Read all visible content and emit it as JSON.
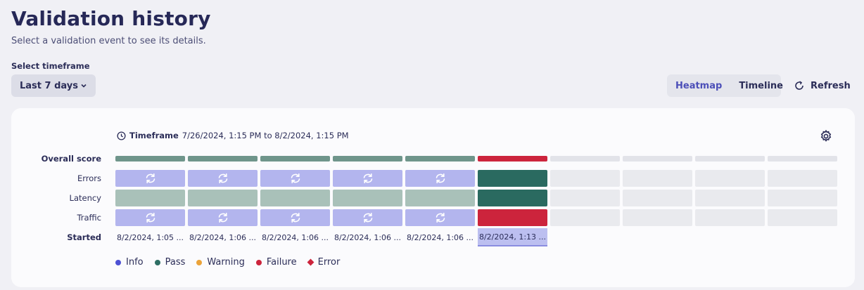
{
  "header": {
    "title": "Validation history",
    "subtitle": "Select a validation event to see its details."
  },
  "timeframe_select": {
    "label": "Select timeframe",
    "value": "Last 7 days"
  },
  "view_toggle": {
    "options": [
      "Heatmap",
      "Timeline"
    ],
    "active": "Heatmap"
  },
  "refresh": {
    "label": "Refresh"
  },
  "heatmap": {
    "timeframe_prefix": "Timeframe",
    "timeframe_range": "7/26/2024, 1:15 PM to 8/2/2024, 1:15 PM",
    "row_labels": {
      "overall": "Overall score",
      "errors": "Errors",
      "latency": "Latency",
      "traffic": "Traffic",
      "started": "Started"
    },
    "columns": [
      {
        "overall": "pass-muted",
        "errors": "info-running",
        "latency": "pass-muted",
        "traffic": "info-running",
        "started": "8/2/2024, 1:05 ..."
      },
      {
        "overall": "pass-muted",
        "errors": "info-running",
        "latency": "pass-muted",
        "traffic": "info-running",
        "started": "8/2/2024, 1:06 ..."
      },
      {
        "overall": "pass-muted",
        "errors": "info-running",
        "latency": "pass-muted",
        "traffic": "info-running",
        "started": "8/2/2024, 1:06 ..."
      },
      {
        "overall": "pass-muted",
        "errors": "info-running",
        "latency": "pass-muted",
        "traffic": "info-running",
        "started": "8/2/2024, 1:06 ..."
      },
      {
        "overall": "pass-muted",
        "errors": "info-running",
        "latency": "pass-muted",
        "traffic": "info-running",
        "started": "8/2/2024, 1:06 ..."
      },
      {
        "overall": "failure",
        "errors": "pass",
        "latency": "pass",
        "traffic": "failure",
        "started": "8/2/2024, 1:13 ...",
        "selected": true
      },
      {
        "overall": "empty",
        "errors": "empty",
        "latency": "empty",
        "traffic": "empty",
        "started": ""
      },
      {
        "overall": "empty",
        "errors": "empty",
        "latency": "empty",
        "traffic": "empty",
        "started": ""
      },
      {
        "overall": "empty",
        "errors": "empty",
        "latency": "empty",
        "traffic": "empty",
        "started": ""
      },
      {
        "overall": "empty",
        "errors": "empty",
        "latency": "empty",
        "traffic": "empty",
        "started": ""
      }
    ],
    "colors": {
      "pass-muted": "#6f958b",
      "pass-muted-cell": "#a9c1b9",
      "info-running": "#b3b5ee",
      "pass": "#2a6a60",
      "failure": "#cc243c",
      "empty": "#e9eaee",
      "empty-overall": "#e2e3e9"
    }
  },
  "legend": [
    {
      "label": "Info",
      "color": "#4d51d4",
      "shape": "dot"
    },
    {
      "label": "Pass",
      "color": "#2e6e64",
      "shape": "dot"
    },
    {
      "label": "Warning",
      "color": "#eba33a",
      "shape": "dot"
    },
    {
      "label": "Failure",
      "color": "#cc243c",
      "shape": "dot"
    },
    {
      "label": "Error",
      "color": "#cc243c",
      "shape": "diamond"
    }
  ]
}
